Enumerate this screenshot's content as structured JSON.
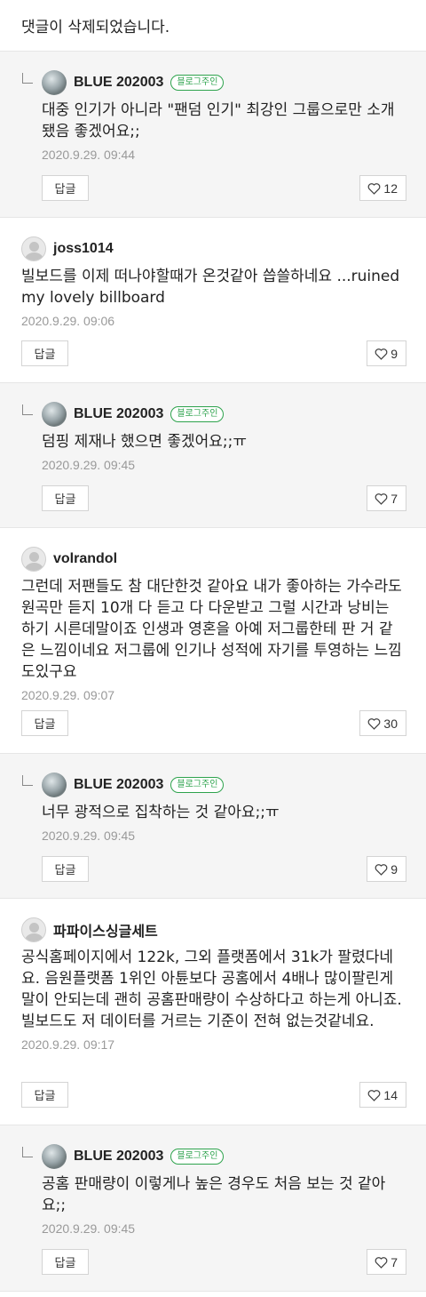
{
  "deleted_notice": "댓글이 삭제되었습니다.",
  "reply_label": "답글",
  "owner_badge": "블로그주인",
  "comments": [
    {
      "author": "BLUE 202003",
      "text": "대중 인기가 아니라 \"팬덤 인기\" 최강인 그룹으로만 소개됐음 좋겠어요;;",
      "date": "2020.9.29. 09:44",
      "likes": "12"
    },
    {
      "author": "joss1014",
      "text": "빌보드를 이제 떠나야할때가 온것같아 씁쓸하네요 ...ruined my lovely billboard",
      "date": "2020.9.29. 09:06",
      "likes": "9"
    },
    {
      "author": "BLUE 202003",
      "text": "덤핑 제재나 했으면 좋겠어요;;ㅠ",
      "date": "2020.9.29. 09:45",
      "likes": "7"
    },
    {
      "author": "volrandol",
      "text": "그런데 저팬들도 참 대단한것 같아요 내가 좋아하는 가수라도 원곡만 듣지 10개 다 듣고 다 다운받고 그럴 시간과 낭비는 하기 시른데말이죠 인생과 영혼을 아예 저그룹한테 판 거 같은 느낌이네요 저그룹에 인기나 성적에 자기를 투영하는 느낌도있구요",
      "date": "2020.9.29. 09:07",
      "likes": "30"
    },
    {
      "author": "BLUE 202003",
      "text": "너무 광적으로 집착하는 것 같아요;;ㅠ",
      "date": "2020.9.29. 09:45",
      "likes": "9"
    },
    {
      "author": "파파이스싱글세트",
      "text": "공식홈페이지에서 122k, 그외 플랫폼에서 31k가 팔렸다네요. 음원플랫폼 1위인 아튠보다 공홈에서 4배나 많이팔린게 말이 안되는데 괜히 공홈판매량이 수상하다고 하는게 아니죠. 빌보드도 저 데이터를 거르는 기준이 전혀 없는것같네요.",
      "date": "2020.9.29. 09:17",
      "likes": "14"
    },
    {
      "author": "BLUE 202003",
      "text": "공홈 판매량이 이렇게나 높은 경우도 처음 보는 것 같아요;;",
      "date": "2020.9.29. 09:45",
      "likes": "7"
    }
  ]
}
